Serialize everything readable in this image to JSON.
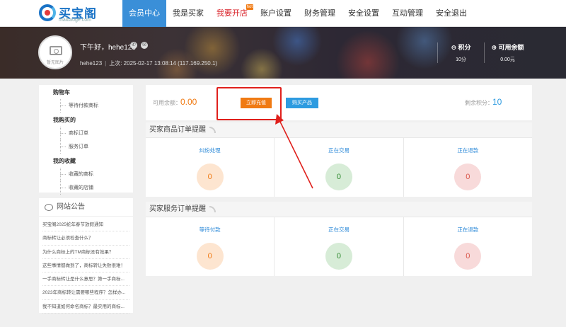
{
  "header": {
    "logo_text": "买宝阁",
    "logo_sub": "maibaoge.com",
    "nav": [
      {
        "label": "会员中心",
        "active": true
      },
      {
        "label": "我是买家"
      },
      {
        "label": "我要开店",
        "hot": true,
        "badge": "hot"
      },
      {
        "label": "账户设置"
      },
      {
        "label": "财务管理"
      },
      {
        "label": "安全设置"
      },
      {
        "label": "互动管理"
      },
      {
        "label": "安全退出"
      }
    ]
  },
  "profile": {
    "avatar_text": "暂无图片",
    "greeting": "下午好，hehe123",
    "username": "hehe123",
    "last_login": "上次: 2025-02-17 13:08:14 (117.169.250.1)",
    "stats": [
      {
        "label": "⊖ 积分",
        "value": "10分"
      },
      {
        "label": "⊕ 可用余额",
        "value": "0.00元"
      }
    ]
  },
  "sidebar": {
    "groups": [
      {
        "title": "购物车",
        "items": [
          "等待付款商标"
        ]
      },
      {
        "title": "我购买的",
        "items": [
          "商标订单",
          "服务订单"
        ]
      },
      {
        "title": "我的收藏",
        "items": [
          "收藏的商标",
          "收藏的店铺"
        ]
      }
    ]
  },
  "notice": {
    "title": "网站公告",
    "items": [
      "买宝阁2025蛇年春节放假通知",
      "商标转让必须检查什么？",
      "为什么商标上的TM商标没有效果？",
      "这些事情都做到了，商标转让失败很难！",
      "一手商标转让是什么意思？第一手商标...",
      "2023年商标转让需要哪些程序？怎样办...",
      "我不知道如何命名商标？最实用的商标..."
    ]
  },
  "balance": {
    "label": "可用余额：",
    "value": "0.00",
    "recharge_label": "立即充值",
    "buy_label": "购买产品",
    "points_label": "剩余积分：",
    "points_value": "10"
  },
  "goods_orders": {
    "title": "买家商品订单提醒",
    "cols": [
      {
        "label": "纠纷处理",
        "count": "0",
        "color": "#f07a13"
      },
      {
        "label": "正在交易",
        "count": "0",
        "color": "#2f8a2f"
      },
      {
        "label": "正在退款",
        "count": "0",
        "color": "#d9564a"
      }
    ]
  },
  "service_orders": {
    "title": "买家服务订单提醒",
    "cols": [
      {
        "label": "等待付款",
        "count": "0",
        "color": "#f07a13"
      },
      {
        "label": "正在交易",
        "count": "0",
        "color": "#2f8a2f"
      },
      {
        "label": "正在退款",
        "count": "0",
        "color": "#d9564a"
      }
    ]
  }
}
